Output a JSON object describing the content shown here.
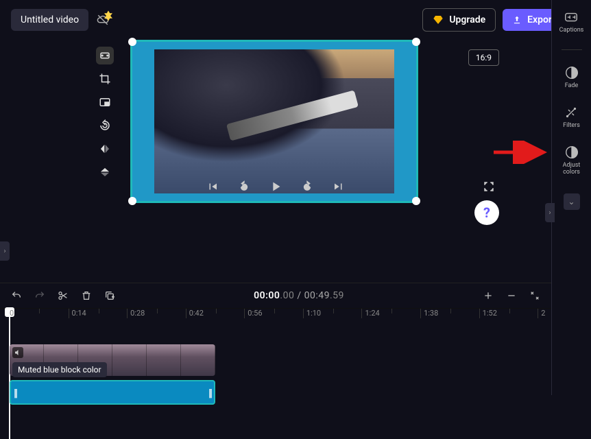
{
  "header": {
    "title": "Untitled video",
    "upgrade_label": "Upgrade",
    "export_label": "Export"
  },
  "aspect_ratio": "16:9",
  "playback": {
    "current_time": "00:00",
    "current_frames": ".00",
    "separator": " / ",
    "total_time": "00:49",
    "total_frames": ".59"
  },
  "ruler": {
    "ticks": [
      "0",
      "0:14",
      "0:28",
      "0:42",
      "0:56",
      "1:10",
      "1:24",
      "1:38",
      "1:52",
      "2"
    ]
  },
  "right_sidebar": {
    "captions": "Captions",
    "fade": "Fade",
    "filters": "Filters",
    "adjust_colors": "Adjust\ncolors"
  },
  "clip": {
    "tooltip": "Muted blue block color",
    "color": "#0a8ac0"
  },
  "help_label": "?"
}
